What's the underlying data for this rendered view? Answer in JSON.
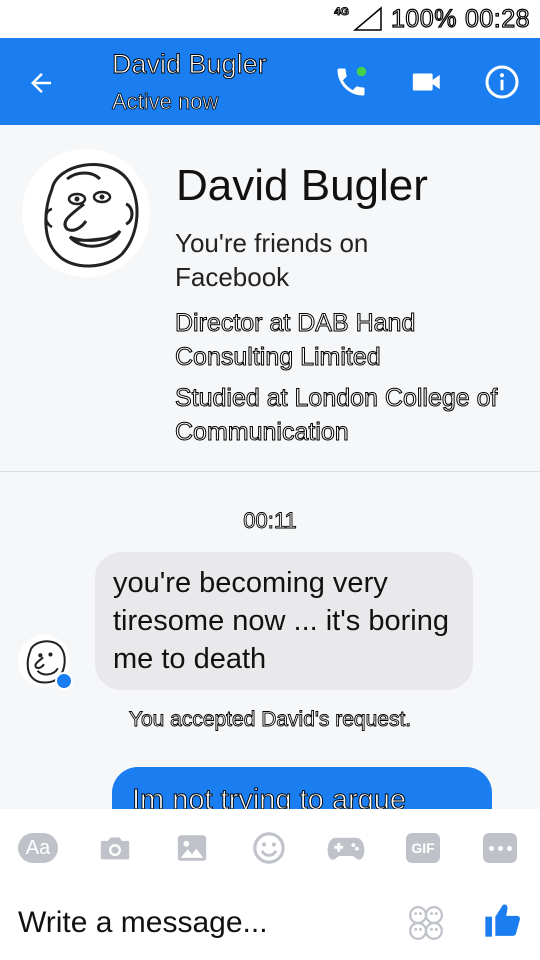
{
  "status_bar": {
    "network": "4G",
    "battery": "100%",
    "time": "00:28"
  },
  "header": {
    "title": "David Bugler",
    "subtitle": "Active now",
    "back_icon": "arrow-left-icon",
    "call_icon": "phone-icon",
    "video_icon": "video-camera-icon",
    "info_icon": "info-icon"
  },
  "profile": {
    "name": "David Bugler",
    "friends_text": "You're friends on Facebook",
    "work": "Director at DAB Hand Consulting Limited",
    "education": "Studied at London College of Communication"
  },
  "conversation": {
    "timestamp": "00:11",
    "incoming_message": "you're becoming very tiresome now ... it's boring me to death",
    "system_note": "You accepted David's request.",
    "outgoing_message": "Im not trying to argue"
  },
  "toolbar": {
    "text_label": "Aa",
    "gif_label": "GIF",
    "icons": [
      "text-style-icon",
      "camera-icon",
      "image-icon",
      "emoji-icon",
      "game-controller-icon",
      "gif-icon",
      "more-icon"
    ]
  },
  "composer": {
    "placeholder": "Write a message...",
    "value": ""
  },
  "colors": {
    "accent": "#1a7df0",
    "bubble_in": "#e9e9eb",
    "toolbar_icon": "#bfc3c9",
    "online_dot": "#43d04c"
  }
}
